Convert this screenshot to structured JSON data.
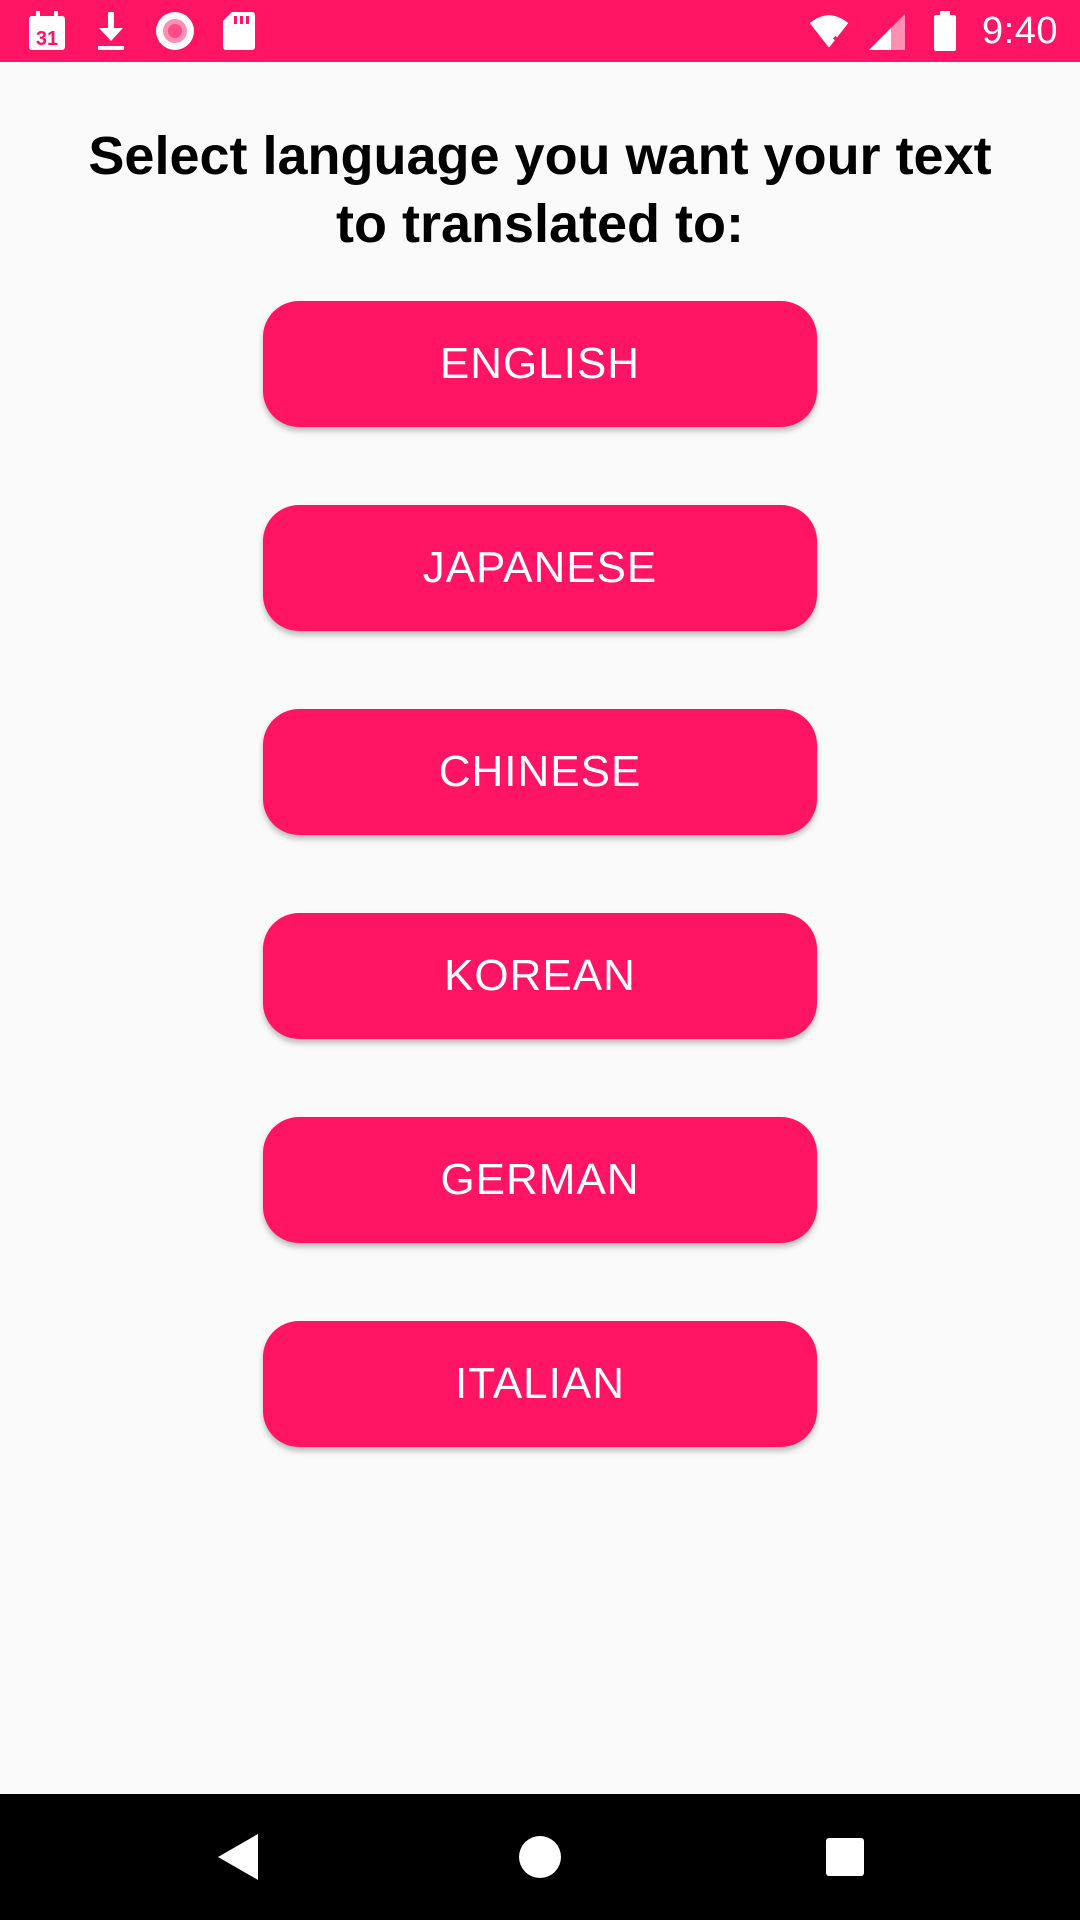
{
  "status_bar": {
    "time": "9:40",
    "left_icons": [
      "calendar-icon",
      "download-icon",
      "record-icon",
      "sd-card-icon"
    ],
    "calendar_day": "31",
    "right_icons": [
      "wifi-icon",
      "signal-icon",
      "battery-icon"
    ],
    "color": "#ff1563"
  },
  "main": {
    "title": "Select language you want your text to translated to:",
    "buttons": [
      {
        "label": "ENGLISH"
      },
      {
        "label": "JAPANESE"
      },
      {
        "label": "CHINESE"
      },
      {
        "label": "KOREAN"
      },
      {
        "label": "GERMAN"
      },
      {
        "label": "ITALIAN"
      }
    ],
    "button_color": "#ff1563"
  },
  "nav_bar": {
    "icons": [
      "back-icon",
      "home-icon",
      "recents-icon"
    ]
  }
}
